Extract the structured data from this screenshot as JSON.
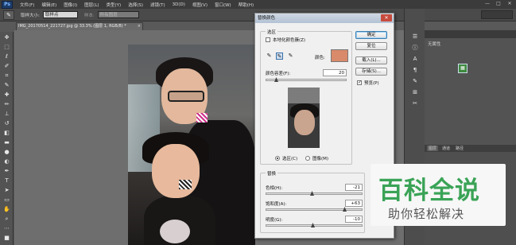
{
  "app": {
    "logo": "Ps",
    "menu": [
      "文件(F)",
      "编辑(E)",
      "图像(I)",
      "图层(L)",
      "类型(Y)",
      "选择(S)",
      "滤镜(T)",
      "3D(D)",
      "视图(V)",
      "窗口(W)",
      "帮助(H)"
    ],
    "window_controls": [
      "—",
      "□",
      "✕"
    ]
  },
  "options_bar": {
    "tool_icon": "eyedropper-icon",
    "sample_size_label": "取样大小:",
    "sample_size_value": "取样点",
    "sample_label": "样本:",
    "sample_value": "所有图层",
    "ring_label": "显示..."
  },
  "document": {
    "tab_title": "IMG_20170514_221727.jpg @ 33.3% (图层 1, RGB/8) *",
    "close": "×"
  },
  "dialog": {
    "title": "替换颜色",
    "close": "✕",
    "selection": {
      "group_title": "选区",
      "localized_label": "本地化颜色簇(Z)",
      "localized_checked": false,
      "color_label": "颜色:",
      "color_value": "#d98a6a",
      "fuzziness_label": "颜色容差(F):",
      "fuzziness_value": "20",
      "fuzziness_fraction": 0.1,
      "radio_selection": "选区(C)",
      "radio_image": "图像(M)",
      "selected_mode": "selection"
    },
    "replacement": {
      "group_title": "替换",
      "hue_label": "色相(H):",
      "hue_value": "-21",
      "saturation_label": "饱和度(A):",
      "saturation_value": "+63",
      "lightness_label": "明度(G):",
      "lightness_value": "-10"
    },
    "buttons": {
      "ok": "确定",
      "reset": "复位",
      "load": "载入(L)...",
      "save": "存储(S)...",
      "preview_label": "预览(P)",
      "preview_checked": true
    }
  },
  "panels": {
    "properties_title": "无属性",
    "layers_tabs": [
      "图层",
      "通道",
      "路径"
    ]
  },
  "watermark": {
    "main": "百科全说",
    "sub": "助你轻松解决"
  }
}
